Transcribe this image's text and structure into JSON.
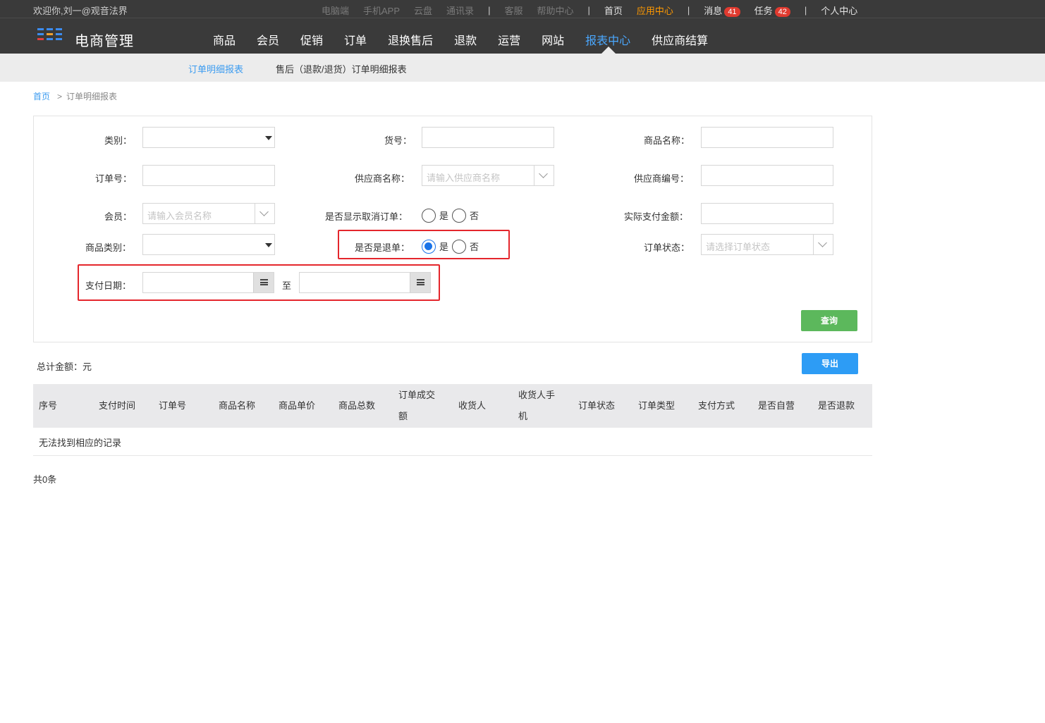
{
  "topbar": {
    "welcome": "欢迎你,刘一@观音法界",
    "links_dim": [
      "电脑端",
      "手机APP",
      "云盘",
      "通讯录"
    ],
    "links_dim2": [
      "客服",
      "帮助中心"
    ],
    "home": "首页",
    "app_center": "应用中心",
    "messages": "消息",
    "messages_count": "41",
    "tasks": "任务",
    "tasks_count": "42",
    "personal": "个人中心",
    "separator": "|"
  },
  "brand": "电商管理",
  "main_nav": [
    "商品",
    "会员",
    "促销",
    "订单",
    "退换售后",
    "退款",
    "运营",
    "网站",
    "报表中心",
    "供应商结算"
  ],
  "main_nav_active": "报表中心",
  "sub_nav": {
    "active": "订单明细报表",
    "other": "售后（退款/退货）订单明细报表"
  },
  "breadcrumb": {
    "home": "首页",
    "arrow": ">",
    "current": "订单明细报表"
  },
  "filters": {
    "category_label": "类别：",
    "sku_label": "货号：",
    "product_name_label": "商品名称：",
    "order_no_label": "订单号：",
    "supplier_name_label": "供应商名称：",
    "supplier_name_placeholder": "请输入供应商名称",
    "supplier_code_label": "供应商编号：",
    "member_label": "会员：",
    "member_placeholder": "请输入会员名称",
    "show_cancelled_label": "是否显示取消订单：",
    "yes": "是",
    "no": "否",
    "actual_paid_label": "实际支付金额：",
    "product_category_label": "商品类别：",
    "is_refund_label": "是否是退单：",
    "order_status_label": "订单状态：",
    "order_status_placeholder": "请选择订单状态",
    "pay_date_label": "支付日期：",
    "to": "至",
    "query_button": "查询"
  },
  "export_button": "导出",
  "total_amount": "总计金额：元",
  "table": {
    "headers": [
      "序号",
      "支付时间",
      "订单号",
      "商品名称",
      "商品单价",
      "商品总数",
      "订单成交额",
      "收货人",
      "收货人手机",
      "订单状态",
      "订单类型",
      "支付方式",
      "是否自营",
      "是否退款"
    ],
    "header_lines": {
      "deal_amount_1": "订单成交",
      "deal_amount_2": "额",
      "receiver_phone_1": "收货人手",
      "receiver_phone_2": "机"
    },
    "empty_text": "无法找到相应的记录"
  },
  "record_count": "共0条",
  "colors": {
    "header_bg": "#3a3a3a",
    "accent_blue": "#3c9cf0",
    "app_center_orange": "#ff9900",
    "badge_red": "#e03a2f",
    "query_green": "#5cb85c",
    "export_blue": "#2d9cf5",
    "highlight_red": "#e4262c"
  }
}
